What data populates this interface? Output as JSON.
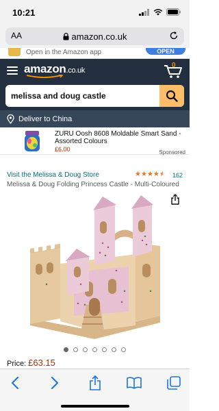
{
  "status_bar": {
    "time": "10:21"
  },
  "browser": {
    "aa_label": "AA",
    "url": "amazon.co.uk"
  },
  "app_banner": {
    "text": "Open in the Amazon app",
    "button": "OPEN"
  },
  "header": {
    "logo": "amazon",
    "logo_tld": ".co.uk",
    "cart_count": "0"
  },
  "search": {
    "query": "melissa and doug castle"
  },
  "delivery": {
    "text": "Deliver to China"
  },
  "sponsored_product": {
    "title": "ZURU Oosh 8608 Moldable Smart Sand - Assorted Colours",
    "price": "£6.00",
    "label": "Sponsored"
  },
  "product": {
    "store_link": "Visit the Melissa & Doug Store",
    "rating": 4.5,
    "review_count": "162",
    "title": "Melissa & Doug Folding Princess Castle - Multi-Coloured",
    "image_count": 7,
    "active_image": 0,
    "price_label": "Price:",
    "price": "£63.15"
  },
  "toolbar": {
    "buttons": [
      "back-icon",
      "forward-icon",
      "share-icon",
      "bookmarks-icon",
      "tabs-icon"
    ]
  },
  "colors": {
    "amazon_dark": "#232f3e",
    "deliver_bar": "#37475a",
    "search_button": "#febd69",
    "link": "#007185",
    "price": "#b12704",
    "star": "#de7921",
    "safari_blue": "#1a73e8"
  }
}
